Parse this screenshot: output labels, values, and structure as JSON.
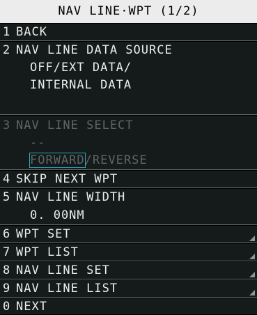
{
  "menu": {
    "title": "NAV LINE·WPT (1/2)",
    "items": [
      {
        "number": "1",
        "label": "BACK"
      },
      {
        "number": "2",
        "label": "NAV LINE DATA SOURCE",
        "options_line1": "OFF/EXT DATA/",
        "options_line2": "INTERNAL DATA"
      },
      {
        "number": "3",
        "label": "NAV LINE SELECT",
        "value": "--",
        "option_a": "FORWARD",
        "separator": "/",
        "option_b": "REVERSE",
        "disabled": true
      },
      {
        "number": "4",
        "label": "SKIP NEXT WPT"
      },
      {
        "number": "5",
        "label": "NAV LINE WIDTH",
        "value": "0. 00NM"
      },
      {
        "number": "6",
        "label": "WPT SET"
      },
      {
        "number": "7",
        "label": "WPT LIST"
      },
      {
        "number": "8",
        "label": "NAV LINE SET"
      },
      {
        "number": "9",
        "label": "NAV LINE LIST"
      },
      {
        "number": "0",
        "label": "NEXT"
      }
    ]
  }
}
